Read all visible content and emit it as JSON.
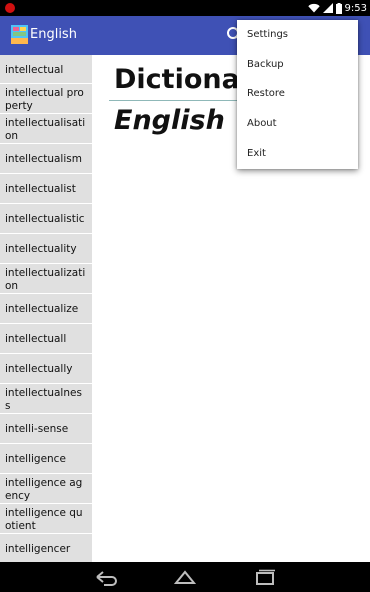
{
  "status_bar": {
    "time": "9:53",
    "icons": [
      "recording-icon",
      "wifi-icon",
      "signal-icon",
      "battery-icon"
    ]
  },
  "action_bar": {
    "title": "English",
    "background_color": "#3f51b5",
    "icons": [
      "app-logo-icon",
      "search-icon"
    ]
  },
  "word_list": {
    "background_color": "#e0e0e0",
    "items": [
      {
        "label": "intellectual",
        "lines": 1
      },
      {
        "label": "intellectual property",
        "lines": 2
      },
      {
        "label": "intellectualisation",
        "lines": 2
      },
      {
        "label": "intellectualism",
        "lines": 2
      },
      {
        "label": "intellectualist",
        "lines": 2
      },
      {
        "label": "intellectualistic",
        "lines": 2
      },
      {
        "label": "intellectuality",
        "lines": 2
      },
      {
        "label": "intellectualization",
        "lines": 2
      },
      {
        "label": "intellectualize",
        "lines": 2
      },
      {
        "label": "intellectuall",
        "lines": 2
      },
      {
        "label": "intellectually",
        "lines": 2
      },
      {
        "label": "intellectualness",
        "lines": 2
      },
      {
        "label": "intelli-sense",
        "lines": 2
      },
      {
        "label": "intelligence",
        "lines": 2
      },
      {
        "label": "intelligence agency",
        "lines": 2
      },
      {
        "label": "intelligence quotient",
        "lines": 2
      },
      {
        "label": "intelligencer",
        "lines": 2
      }
    ]
  },
  "content": {
    "title": "Dictionary",
    "subtitle": "English"
  },
  "overflow_menu": {
    "items": [
      "Settings",
      "Backup",
      "Restore",
      "About",
      "Exit"
    ]
  },
  "nav_bar": {
    "icons": [
      "back-icon",
      "home-icon",
      "recents-icon"
    ]
  }
}
